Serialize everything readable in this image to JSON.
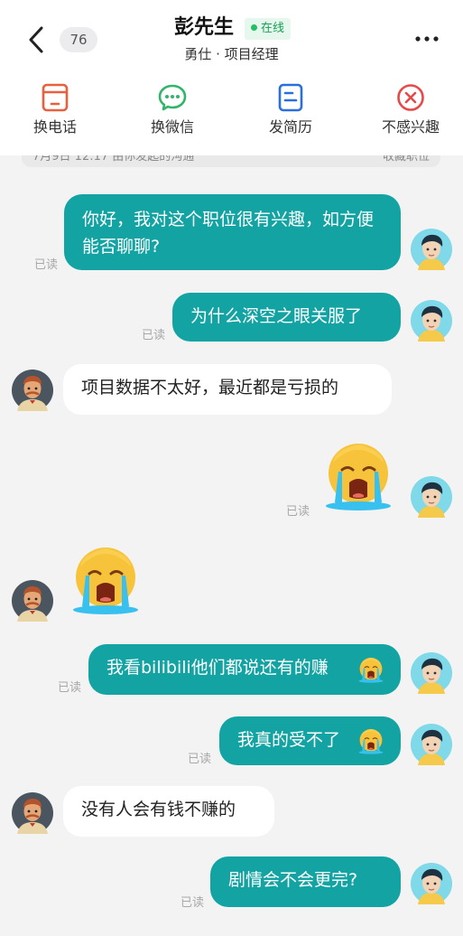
{
  "header": {
    "unread_count": "76",
    "contact_name": "彭先生",
    "online_status": "在线",
    "subtitle": "勇仕 · 项目经理"
  },
  "actions": [
    {
      "label": "换电话",
      "icon": "phone-card-icon"
    },
    {
      "label": "换微信",
      "icon": "wechat-icon"
    },
    {
      "label": "发简历",
      "icon": "resume-icon"
    },
    {
      "label": "不感兴趣",
      "icon": "not-interested-icon"
    }
  ],
  "banner": {
    "left_text": "7月9日 12:17 由你发起的沟通",
    "right_text": "收藏职位"
  },
  "read_label": "已读",
  "messages": [
    {
      "dir": "out",
      "text": "你好，我对这个职位很有兴趣，如方便能否聊聊?"
    },
    {
      "dir": "out",
      "text": "为什么深空之眼关服了"
    },
    {
      "dir": "in",
      "text": "项目数据不太好，最近都是亏损的"
    },
    {
      "dir": "out",
      "type": "emoji",
      "emoji": "loudly-crying-face"
    },
    {
      "dir": "in",
      "type": "emoji",
      "emoji": "loudly-crying-face"
    },
    {
      "dir": "out",
      "text": "我看bilibili他们都说还有的赚"
    },
    {
      "dir": "out",
      "text": "我真的受不了"
    },
    {
      "dir": "in",
      "text": "没有人会有钱不赚的"
    },
    {
      "dir": "out",
      "text": "剧情会不会更完?"
    }
  ],
  "colors": {
    "outgoing_bubble": "#13a3a3",
    "incoming_bubble": "#ffffff",
    "background": "#f3f3f4",
    "online_green": "#1a9e55"
  }
}
